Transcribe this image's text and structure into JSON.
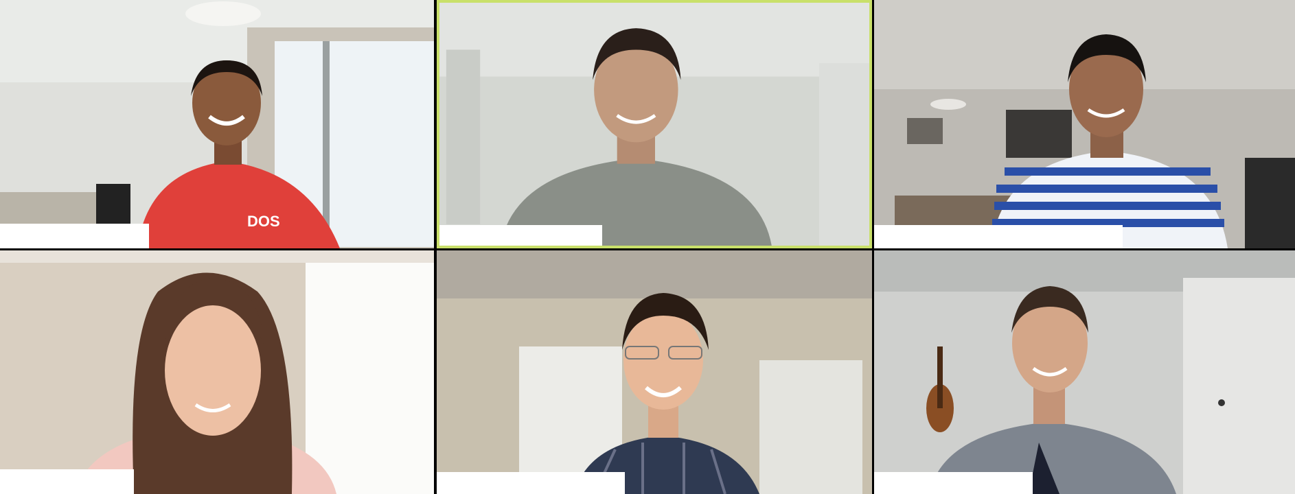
{
  "meeting": {
    "view": "gallery",
    "active_speaker_index": 1,
    "active_speaker_border_color": "#c9e06a"
  },
  "participants": [
    {
      "name": "",
      "shirt_color": "#e0403a",
      "shirt_text": "DOS"
    },
    {
      "name": "",
      "shirt_color": "#8a8f88"
    },
    {
      "name": "",
      "shirt_color": "#2a4fa8"
    },
    {
      "name": "",
      "shirt_color": "#f2c8c0"
    },
    {
      "name": "",
      "shirt_color": "#2f3a52"
    },
    {
      "name": "",
      "shirt_color": "#7e858f"
    }
  ]
}
